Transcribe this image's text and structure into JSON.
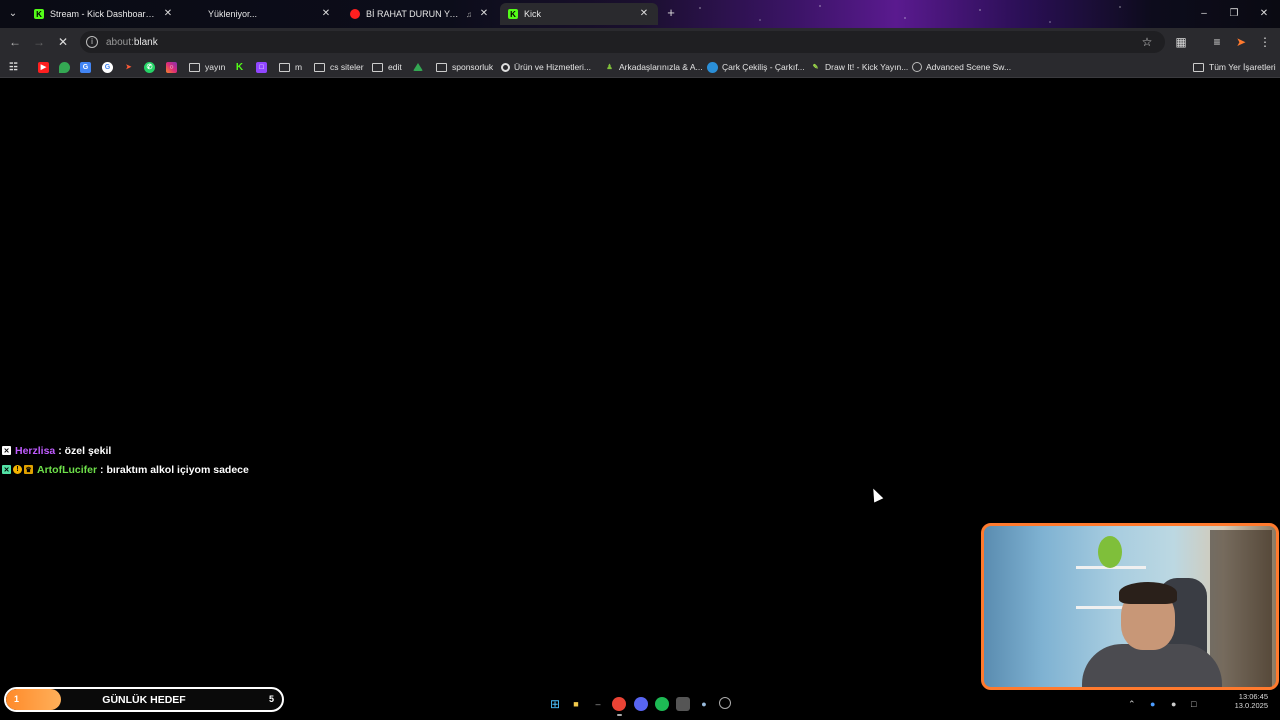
{
  "browser": {
    "tabs": [
      {
        "title": "Stream - Kick Dashboard -",
        "favicon": "kick-icon",
        "active": false
      },
      {
        "title": "Yükleniyor...",
        "favicon": "loading",
        "active": false
      },
      {
        "title": "Bİ RAHAT DURUN YA! | SSn",
        "favicon": "youtube-icon",
        "active": false,
        "muted": true
      },
      {
        "title": "Kick",
        "favicon": "kick-icon",
        "active": true
      }
    ],
    "address": {
      "prefix": "about:",
      "rest": "blank"
    },
    "bookmarks": [
      {
        "label": "yayın",
        "type": "folder"
      },
      {
        "label": "m",
        "type": "folder"
      },
      {
        "label": "cs siteler",
        "type": "folder"
      },
      {
        "label": "edit",
        "type": "folder"
      },
      {
        "label": "sponsorluk",
        "type": "folder"
      },
      {
        "label": "Ürün ve Hizmetleri...",
        "type": "site"
      },
      {
        "label": "Arkadaşlarınızla & A...",
        "type": "site"
      },
      {
        "label": "Çark Çekiliş - Çarkıf...",
        "type": "site"
      },
      {
        "label": "Draw It! - Kick Yayın...",
        "type": "site"
      },
      {
        "label": "Advanced Scene Sw...",
        "type": "site"
      }
    ],
    "all_bookmarks_label": "Tüm Yer İşaretleri"
  },
  "chat": [
    {
      "user": "Herzlisa",
      "separator": " : ",
      "message": "özel şekil"
    },
    {
      "user": "ArtofLucifer",
      "separator": " : ",
      "message": "bıraktım alkol içiyom sadece"
    }
  ],
  "goal": {
    "current": "1",
    "label": "GÜNLÜK HEDEF",
    "target": "5",
    "progress": 0.2
  },
  "clock": {
    "time": "13:06:45",
    "date": "13.0.2025"
  },
  "colors": {
    "accent": "#ff7a2e",
    "kick_green": "#53fc18",
    "user1": "#c05cff",
    "user2": "#6ee04a"
  }
}
